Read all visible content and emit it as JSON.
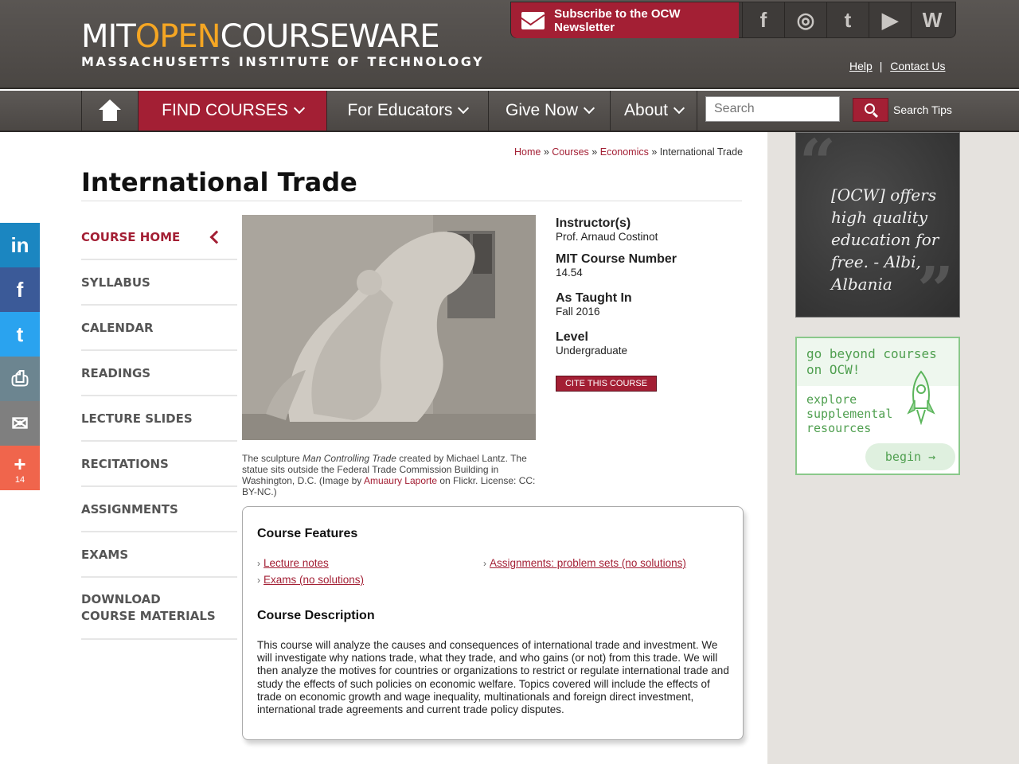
{
  "header": {
    "logo_mit": "MIT",
    "logo_open": "OPEN",
    "logo_courseware": "COURSEWARE",
    "logo_sub": "MASSACHUSETTS INSTITUTE OF TECHNOLOGY",
    "subscribe_label": "Subscribe to the OCW Newsletter",
    "social": [
      "f",
      "◎",
      "t",
      "▶",
      "W"
    ],
    "help": "Help",
    "separator": "|",
    "contact": "Contact Us"
  },
  "nav": {
    "find_courses": "FIND COURSES",
    "for_educators": "For Educators",
    "give_now": "Give Now",
    "about": "About",
    "search_placeholder": "Search",
    "search_tips": "Search Tips"
  },
  "breadcrumb": {
    "home": "Home",
    "courses": "Courses",
    "economics": "Economics",
    "sep": "»",
    "current": "International Trade"
  },
  "page_title": "International Trade",
  "leftnav": [
    "COURSE HOME",
    "SYLLABUS",
    "CALENDAR",
    "READINGS",
    "LECTURE SLIDES",
    "RECITATIONS",
    "ASSIGNMENTS",
    "EXAMS",
    "DOWNLOAD COURSE MATERIALS"
  ],
  "share": {
    "linkedin": "in",
    "facebook": "f",
    "twitter": "t",
    "print": "⎙",
    "email": "✉",
    "more": "+",
    "count": "14"
  },
  "caption": {
    "pre": "The sculpture ",
    "title": "Man Controlling Trade",
    "mid": " created by Michael Lantz. The statue sits outside the Federal Trade Commission Building in Washington, D.C. (Image by ",
    "link": "Amuaury Laporte",
    "post": " on Flickr. License: CC: BY-NC.)"
  },
  "info": {
    "instructor_label": "Instructor(s)",
    "instructor": "Prof. Arnaud Costinot",
    "number_label": "MIT Course Number",
    "number": "14.54",
    "taught_label": "As Taught In",
    "taught": "Fall 2016",
    "level_label": "Level",
    "level": "Undergraduate",
    "cite": "CITE THIS COURSE"
  },
  "features": {
    "heading": "Course Features",
    "items": [
      "Lecture notes",
      "Exams (no solutions)",
      "Assignments: problem sets (no solutions)"
    ],
    "desc_heading": "Course Description",
    "description": "This course will analyze the causes and consequences of international trade and investment. We will investigate why nations trade, what they trade, and who gains (or not) from this trade. We will then analyze the motives for countries or organizations to restrict or regulate international trade and study the effects of such policies on economic welfare. Topics covered will include the effects of trade on economic growth and wage inequality, multinationals and foreign direct investment, international trade agreements and current trade policy disputes."
  },
  "sidebar": {
    "quote": "[OCW] offers high quality education for free. - Albi, Albania",
    "beyond_title": "go beyond courses on OCW!",
    "beyond_sub": "explore supplemental resources",
    "begin": "begin →"
  },
  "colors": {
    "accent": "#a31f34",
    "header_bg": "#4e4a47",
    "logo_orange": "#f5a623",
    "linkedin": "#1b86c1",
    "facebook": "#3b5a98",
    "twitter": "#2aa3ef",
    "print": "#6c8590",
    "email": "#7f7f7f",
    "more": "#f0654c",
    "ocw_green": "#4f9f4f"
  }
}
